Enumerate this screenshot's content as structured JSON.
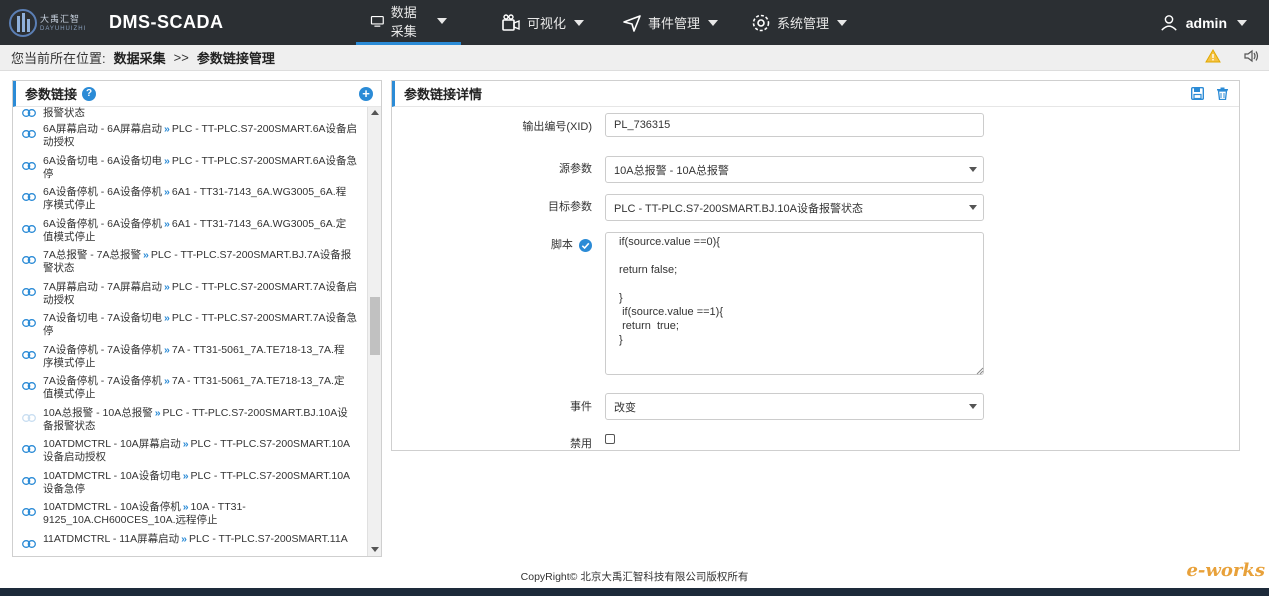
{
  "app": {
    "logo_text": "大禹汇智",
    "logo_sub": "DAYUHUIZHI",
    "title": "DMS-SCADA"
  },
  "nav": [
    {
      "label": "数据采集",
      "icon": "monitor-icon",
      "active": true
    },
    {
      "label": "可视化",
      "icon": "camera-icon",
      "active": false
    },
    {
      "label": "事件管理",
      "icon": "send-icon",
      "active": false
    },
    {
      "label": "系统管理",
      "icon": "gear-icon",
      "active": false
    }
  ],
  "user": {
    "name": "admin",
    "icon": "user-icon"
  },
  "breadcrumb": {
    "prefix": "您当前所在位置:",
    "level1": "数据采集",
    "separator": ">>",
    "level2": "参数链接管理"
  },
  "left_panel": {
    "title": "参数链接",
    "partial_top": "报警状态",
    "items": [
      {
        "src": "6A屏幕启动 - 6A屏幕启动",
        "target": "PLC - TT-PLC.S7-200SMART.6A设备启",
        "tail": "动授权"
      },
      {
        "src": "6A设备切电 - 6A设备切电",
        "target": "PLC - TT-PLC.S7-200SMART.6A设备急",
        "tail": "停"
      },
      {
        "src": "6A设备停机 - 6A设备停机",
        "target": "6A1 - TT31-7143_6A.WG3005_6A.程",
        "tail": "序模式停止"
      },
      {
        "src": "6A设备停机 - 6A设备停机",
        "target": "6A1 - TT31-7143_6A.WG3005_6A.定",
        "tail": "值模式停止"
      },
      {
        "src": "7A总报警 - 7A总报警",
        "target": "PLC - TT-PLC.S7-200SMART.BJ.7A设备报",
        "tail": "警状态"
      },
      {
        "src": "7A屏幕启动 - 7A屏幕启动",
        "target": "PLC - TT-PLC.S7-200SMART.7A设备启",
        "tail": "动授权"
      },
      {
        "src": "7A设备切电 - 7A设备切电",
        "target": "PLC - TT-PLC.S7-200SMART.7A设备急",
        "tail": "停"
      },
      {
        "src": "7A设备停机 - 7A设备停机",
        "target": "7A - TT31-5061_7A.TE718-13_7A.程",
        "tail": "序模式停止"
      },
      {
        "src": "7A设备停机 - 7A设备停机",
        "target": "7A - TT31-5061_7A.TE718-13_7A.定",
        "tail": "值模式停止"
      },
      {
        "src": "10A总报警 - 10A总报警",
        "target": "PLC - TT-PLC.S7-200SMART.BJ.10A设",
        "tail": "备报警状态"
      },
      {
        "src": "10ATDMCTRL - 10A屏幕启动",
        "target": "PLC - TT-PLC.S7-200SMART.10A",
        "tail": "设备启动授权"
      },
      {
        "src": "10ATDMCTRL - 10A设备切电",
        "target": "PLC - TT-PLC.S7-200SMART.10A",
        "tail": "设备急停"
      },
      {
        "src": "10ATDMCTRL - 10A设备停机",
        "target": "10A - TT31-",
        "tail": "9125_10A.CH600CES_10A.远程停止"
      },
      {
        "src": "11ATDMCTRL - 11A屏幕启动",
        "target": "PLC - TT-PLC.S7-200SMART.11A",
        "tail": ""
      }
    ]
  },
  "right_panel": {
    "title": "参数链接详情",
    "xid_label": "输出编号(XID)",
    "xid_value": "PL_736315",
    "source_label": "源参数",
    "source_value": "10A总报警 - 10A总报警",
    "target_label": "目标参数",
    "target_value": "PLC - TT-PLC.S7-200SMART.BJ.10A设备报警状态",
    "script_label": "脚本",
    "script_value": " if(source.value ==0){\n\n return false;\n\n }\n  if(source.value ==1){\n  return  true;\n }",
    "event_label": "事件",
    "event_value": "改变",
    "disabled_label": "禁用"
  },
  "footer": {
    "copyright": "CopyRight© 北京大禹汇智科技有限公司版权所有",
    "watermark": "e-works"
  }
}
